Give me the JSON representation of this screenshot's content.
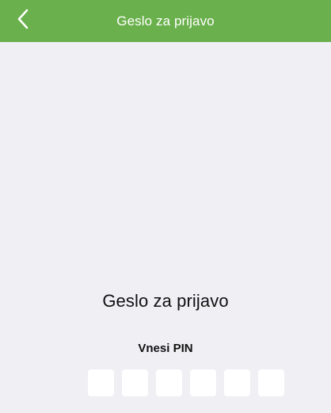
{
  "navbar": {
    "title": "Geslo za prijavo",
    "back_icon": "chevron-left-icon",
    "background_color": "#6ab04c",
    "title_color": "#ffffff"
  },
  "main": {
    "title": "Geslo za prijavo",
    "pin_label": "Vnesi PIN",
    "pin_length": 6
  },
  "colors": {
    "page_background": "#efeff4",
    "pin_box_background": "#ffffff"
  }
}
